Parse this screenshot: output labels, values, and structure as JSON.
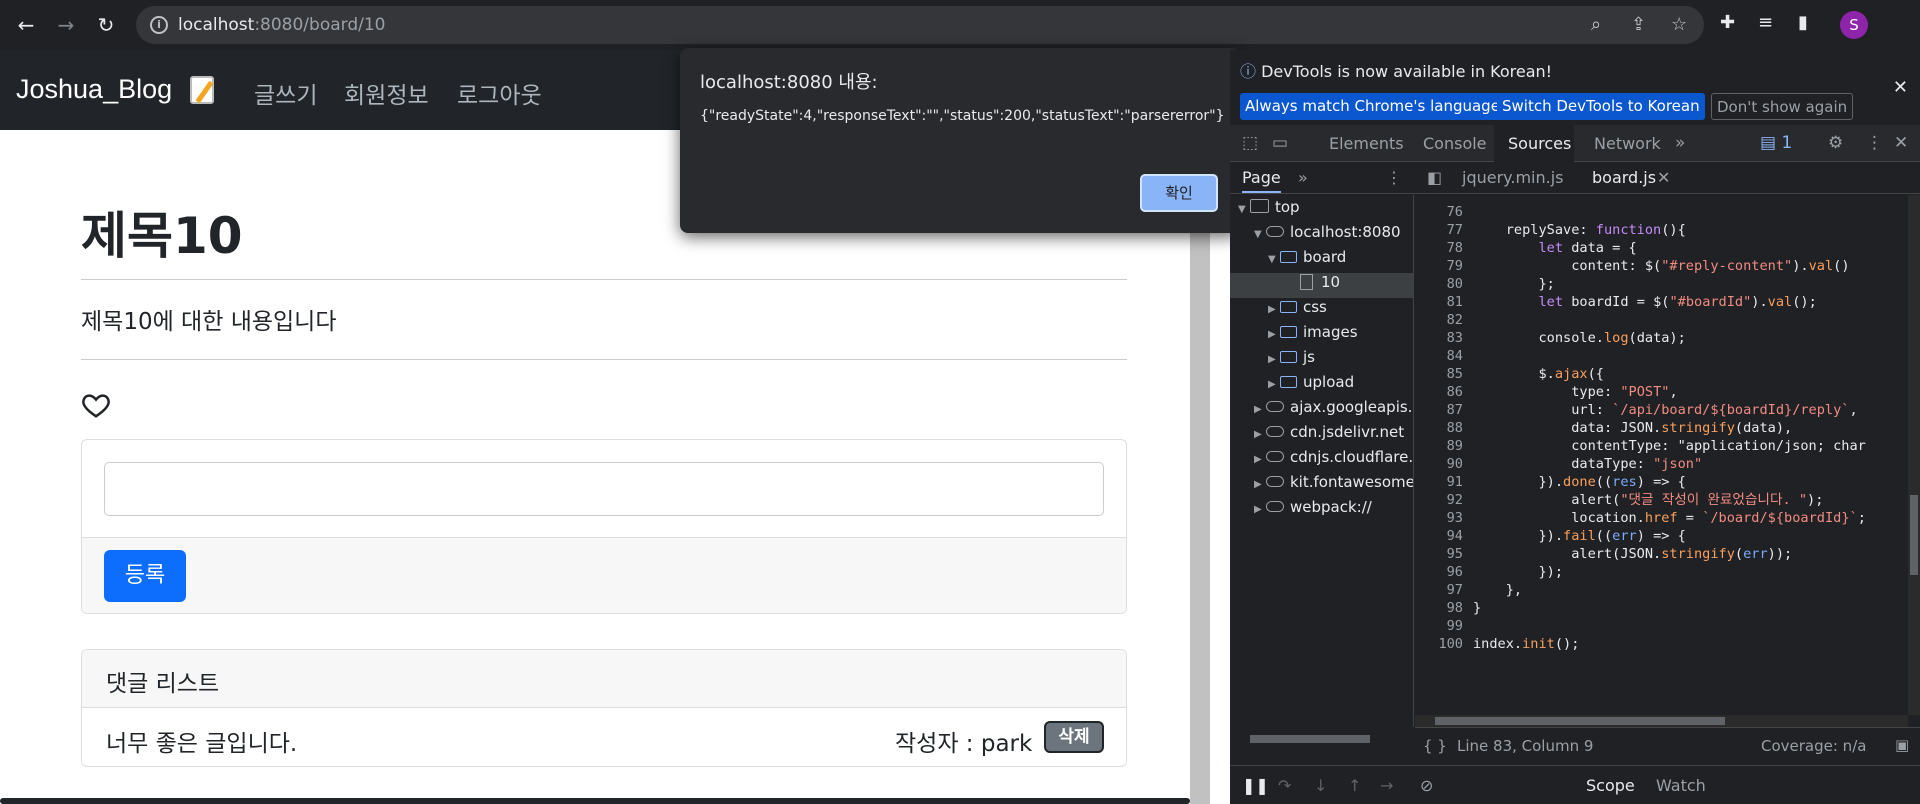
{
  "browser": {
    "url_host": "localhost",
    "url_rest": ":8080/board/10",
    "profile_initial": "S"
  },
  "site": {
    "brand": "Joshua_Blog",
    "nav": [
      "글쓰기",
      "회원정보",
      "로그아웃"
    ],
    "post_title": "제목10",
    "post_body": "제목10에 대한 내용입니다",
    "reply_textarea_value": "",
    "submit_label": "등록",
    "reply_list_header": "댓글 리스트",
    "replies": [
      {
        "content": "너무 좋은 글입니다.",
        "author": "작성자 : park",
        "delete_label": "삭제"
      }
    ]
  },
  "alert": {
    "title": "localhost:8080 내용:",
    "message": "{\"readyState\":4,\"responseText\":\"\",\"status\":200,\"statusText\":\"parsererror\"}",
    "ok_label": "확인"
  },
  "devtools": {
    "infobar_text": "DevTools is now available in Korean!",
    "infobar_buttons": [
      "Always match Chrome's language",
      "Switch DevTools to Korean",
      "Don't show again"
    ],
    "tabs": [
      "Elements",
      "Console",
      "Sources",
      "Network"
    ],
    "active_tab": "Sources",
    "issues_count": "1",
    "page_tab": "Page",
    "file_tabs": [
      "jquery.min.js",
      "board.js"
    ],
    "tree": [
      {
        "label": "top",
        "icon": "window"
      },
      {
        "label": "localhost:8080",
        "icon": "cloud"
      },
      {
        "label": "board",
        "icon": "folder"
      },
      {
        "label": "10",
        "icon": "file"
      },
      {
        "label": "css",
        "icon": "folder"
      },
      {
        "label": "images",
        "icon": "folder"
      },
      {
        "label": "js",
        "icon": "folder"
      },
      {
        "label": "upload",
        "icon": "folder"
      },
      {
        "label": "ajax.googleapis.c",
        "icon": "cloud"
      },
      {
        "label": "cdn.jsdelivr.net",
        "icon": "cloud"
      },
      {
        "label": "cdnjs.cloudflare.c",
        "icon": "cloud"
      },
      {
        "label": "kit.fontawesome.",
        "icon": "cloud"
      },
      {
        "label": "webpack://",
        "icon": "cloud"
      }
    ],
    "code_lines": [
      {
        "n": "76",
        "t": ""
      },
      {
        "n": "77",
        "t": "    replySave: function(){"
      },
      {
        "n": "78",
        "t": "        let data = {"
      },
      {
        "n": "79",
        "t": "            content: $(\"#reply-content\").val()"
      },
      {
        "n": "80",
        "t": "        };"
      },
      {
        "n": "81",
        "t": "        let boardId = $(\"#boardId\").val();"
      },
      {
        "n": "82",
        "t": ""
      },
      {
        "n": "83",
        "t": "        console.log(data);"
      },
      {
        "n": "84",
        "t": ""
      },
      {
        "n": "85",
        "t": "        $.ajax({"
      },
      {
        "n": "86",
        "t": "            type: \"POST\","
      },
      {
        "n": "87",
        "t": "            url: `/api/board/${boardId}/reply`,"
      },
      {
        "n": "88",
        "t": "            data: JSON.stringify(data),"
      },
      {
        "n": "89",
        "t": "            contentType: \"application/json; char"
      },
      {
        "n": "90",
        "t": "            dataType: \"json\""
      },
      {
        "n": "91",
        "t": "        }).done((res) => {"
      },
      {
        "n": "92",
        "t": "            alert(\"댓글 작성이 완료었습니다. \");"
      },
      {
        "n": "93",
        "t": "            location.href = `/board/${boardId}`;"
      },
      {
        "n": "94",
        "t": "        }).fail((err) => {"
      },
      {
        "n": "95",
        "t": "            alert(JSON.stringify(err));"
      },
      {
        "n": "96",
        "t": "        });"
      },
      {
        "n": "97",
        "t": "    },"
      },
      {
        "n": "98",
        "t": "}"
      },
      {
        "n": "99",
        "t": ""
      },
      {
        "n": "100",
        "t": "index.init();"
      }
    ],
    "status_position": "Line 83, Column 9",
    "coverage": "Coverage: n/a",
    "bottom_tabs": [
      "Scope",
      "Watch"
    ]
  }
}
